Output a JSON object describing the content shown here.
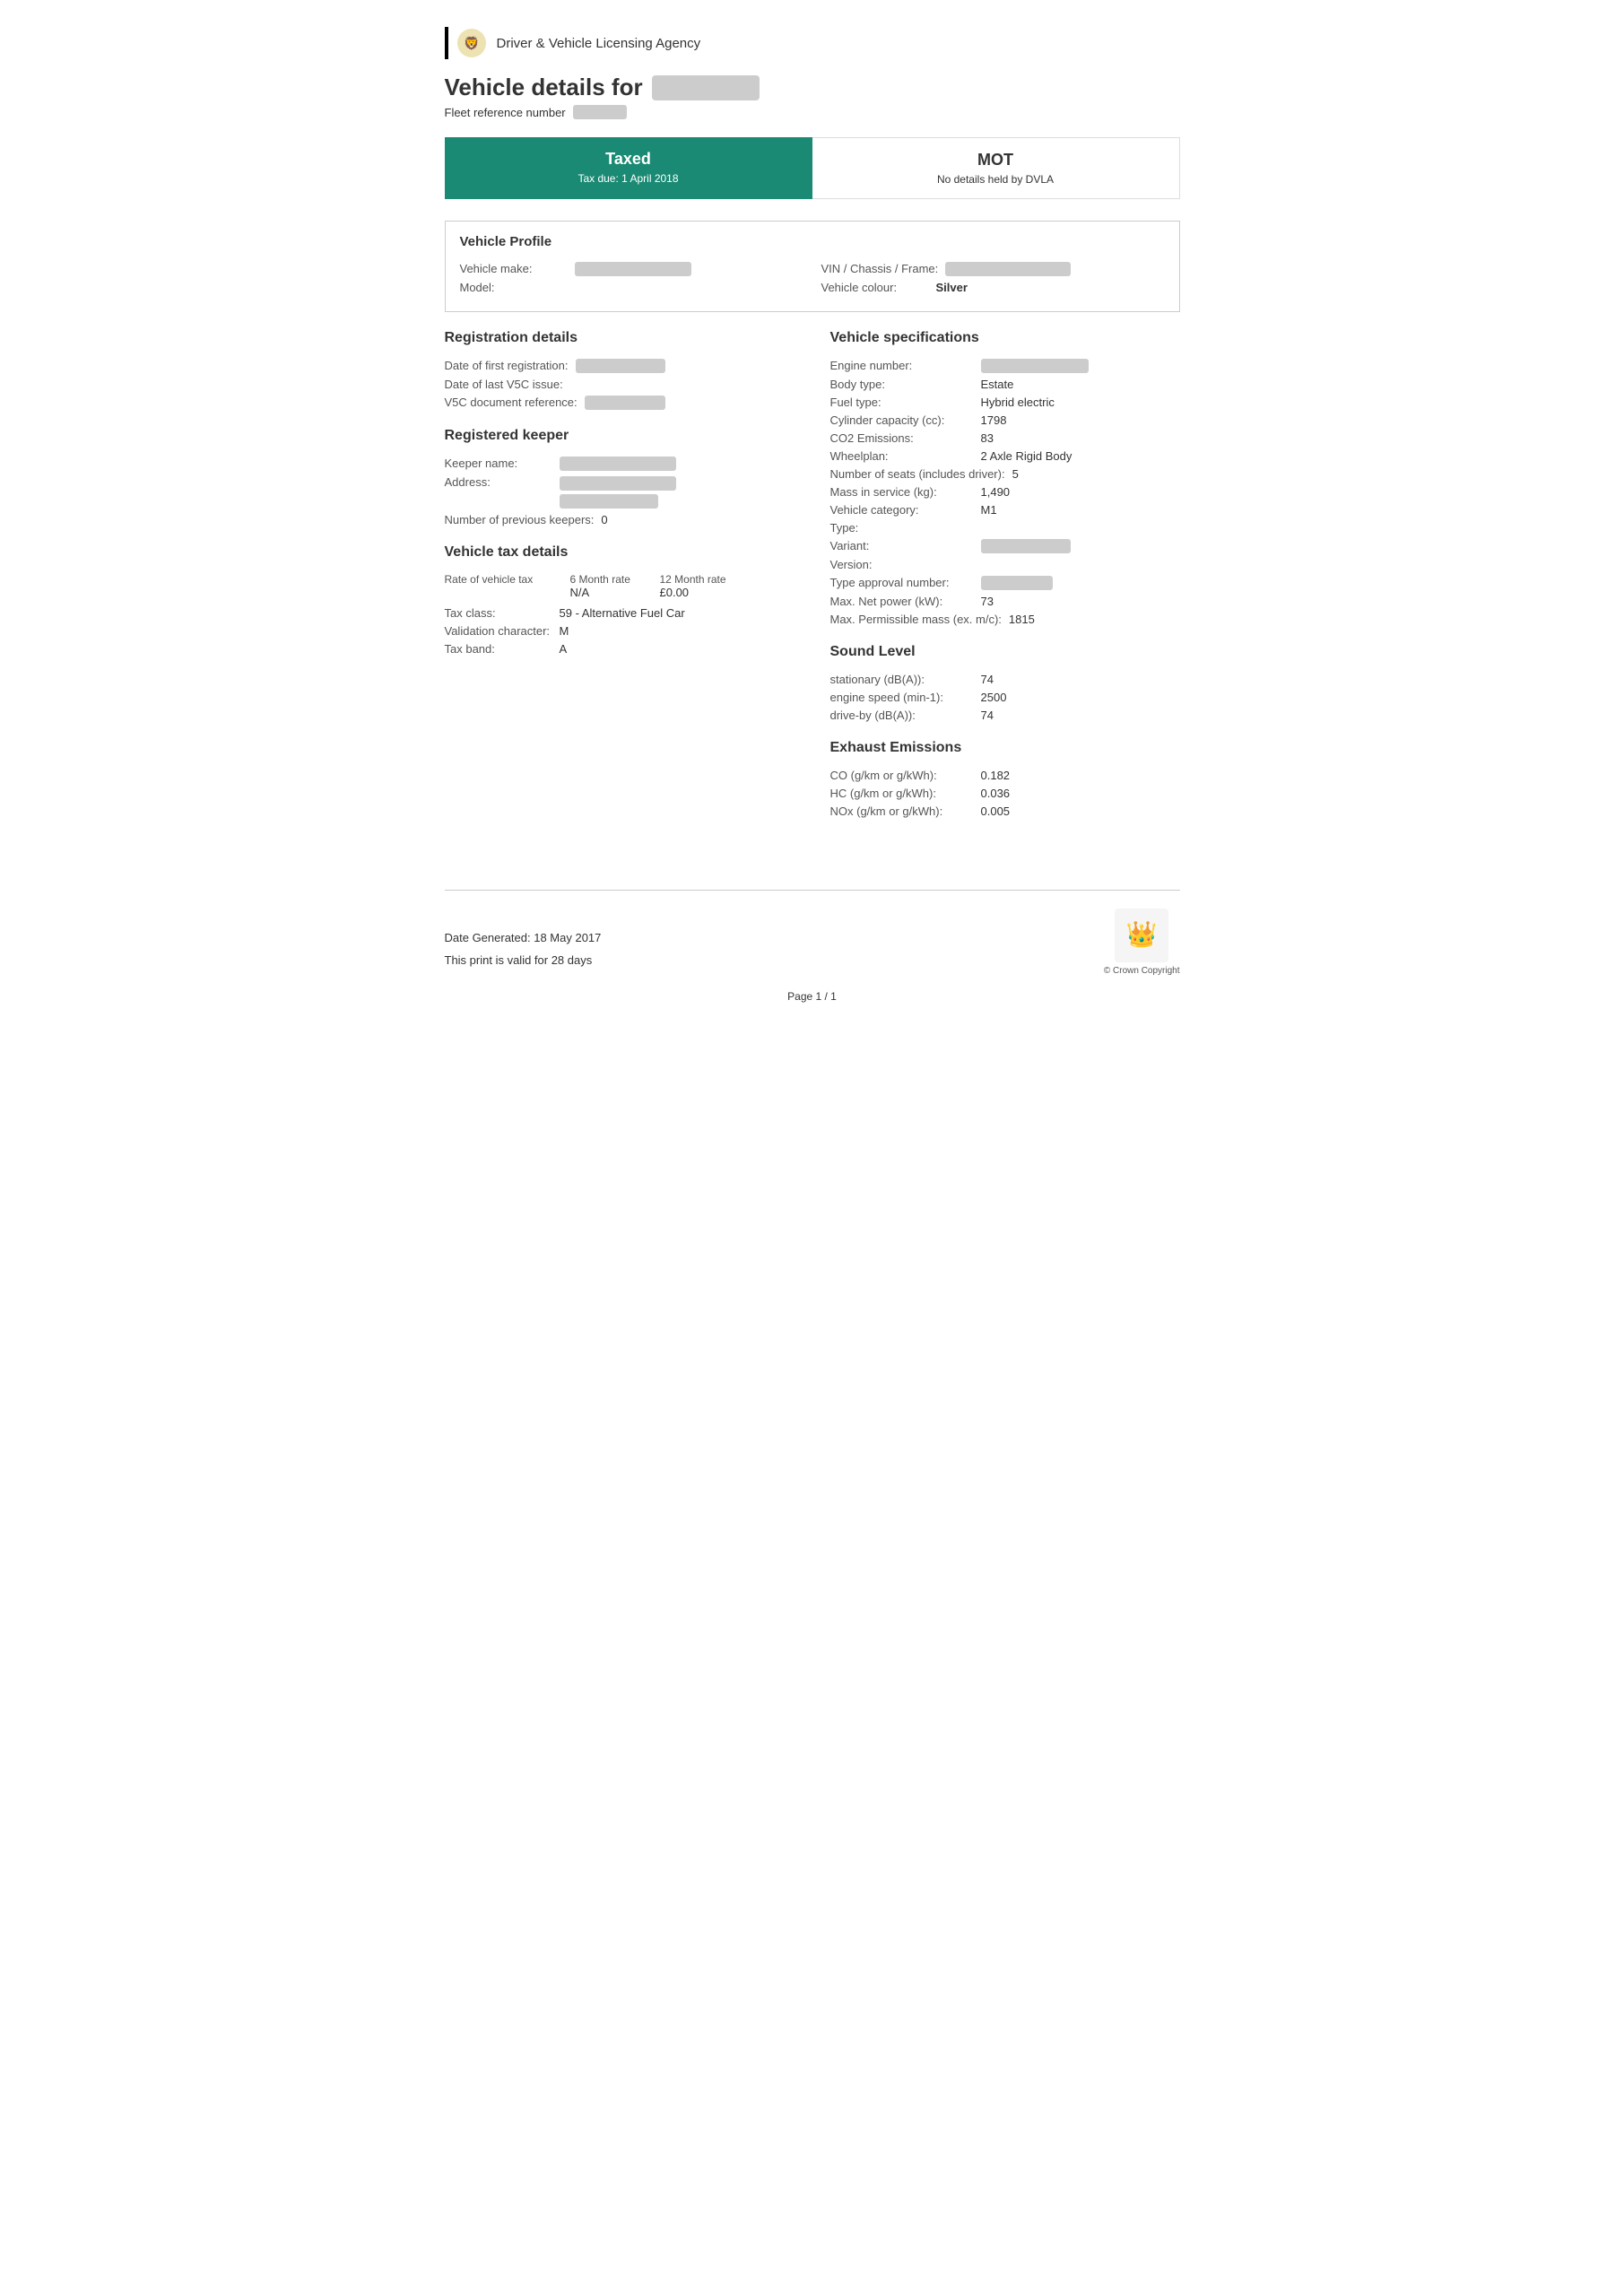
{
  "header": {
    "org_name": "Driver & Vehicle Licensing Agency"
  },
  "page_title": "Vehicle details for",
  "fleet_ref_label": "Fleet reference number",
  "status": {
    "tax_title": "Taxed",
    "tax_sub": "Tax due: 1 April 2018",
    "mot_title": "MOT",
    "mot_sub": "No details held by DVLA"
  },
  "vehicle_profile": {
    "section_title": "Vehicle Profile",
    "make_label": "Vehicle make:",
    "model_label": "Model:",
    "vin_label": "VIN / Chassis / Frame:",
    "colour_label": "Vehicle colour:",
    "colour_value": "Silver"
  },
  "registration": {
    "section_title": "Registration details",
    "first_reg_label": "Date of first registration:",
    "last_v5c_label": "Date of last V5C issue:",
    "v5c_ref_label": "V5C document reference:"
  },
  "keeper": {
    "section_title": "Registered keeper",
    "name_label": "Keeper name:",
    "address_label": "Address:",
    "prev_keepers_label": "Number of previous keepers:",
    "prev_keepers_value": "0"
  },
  "tax_details": {
    "section_title": "Vehicle tax details",
    "rate_label": "Rate of vehicle tax",
    "six_month_header": "6 Month rate",
    "twelve_month_header": "12 Month rate",
    "six_month_value": "N/A",
    "twelve_month_value": "£0.00",
    "tax_class_label": "Tax class:",
    "tax_class_value": "59 - Alternative Fuel Car",
    "validation_label": "Validation character:",
    "validation_value": "M",
    "tax_band_label": "Tax band:",
    "tax_band_value": "A"
  },
  "vehicle_specs": {
    "section_title": "Vehicle specifications",
    "engine_number_label": "Engine number:",
    "body_type_label": "Body type:",
    "body_type_value": "Estate",
    "fuel_type_label": "Fuel type:",
    "fuel_type_value": "Hybrid electric",
    "cylinder_cap_label": "Cylinder capacity (cc):",
    "cylinder_cap_value": "1798",
    "co2_label": "CO2 Emissions:",
    "co2_value": "83",
    "wheelplan_label": "Wheelplan:",
    "wheelplan_value": "2 Axle Rigid Body",
    "seats_label": "Number of seats (includes driver):",
    "seats_value": "5",
    "mass_label": "Mass in service (kg):",
    "mass_value": "1,490",
    "category_label": "Vehicle category:",
    "category_value": "M1",
    "type_label": "Type:",
    "variant_label": "Variant:",
    "version_label": "Version:",
    "type_approval_label": "Type approval number:",
    "net_power_label": "Max. Net power (kW):",
    "net_power_value": "73",
    "max_perm_label": "Max. Permissible mass (ex. m/c):",
    "max_perm_value": "1815"
  },
  "sound_level": {
    "section_title": "Sound Level",
    "stationary_label": "stationary (dB(A)):",
    "stationary_value": "74",
    "engine_speed_label": "engine speed (min-1):",
    "engine_speed_value": "2500",
    "driveby_label": "drive-by (dB(A)):",
    "driveby_value": "74"
  },
  "exhaust": {
    "section_title": "Exhaust Emissions",
    "co_label": "CO (g/km or g/kWh):",
    "co_value": "0.182",
    "hc_label": "HC (g/km or g/kWh):",
    "hc_value": "0.036",
    "nox_label": "NOx (g/km or g/kWh):",
    "nox_value": "0.005"
  },
  "footer": {
    "date_generated": "Date Generated: 18 May 2017",
    "valid_text": "This print is valid for 28 days",
    "crown_copyright": "© Crown Copyright",
    "page_num": "Page 1 / 1"
  }
}
